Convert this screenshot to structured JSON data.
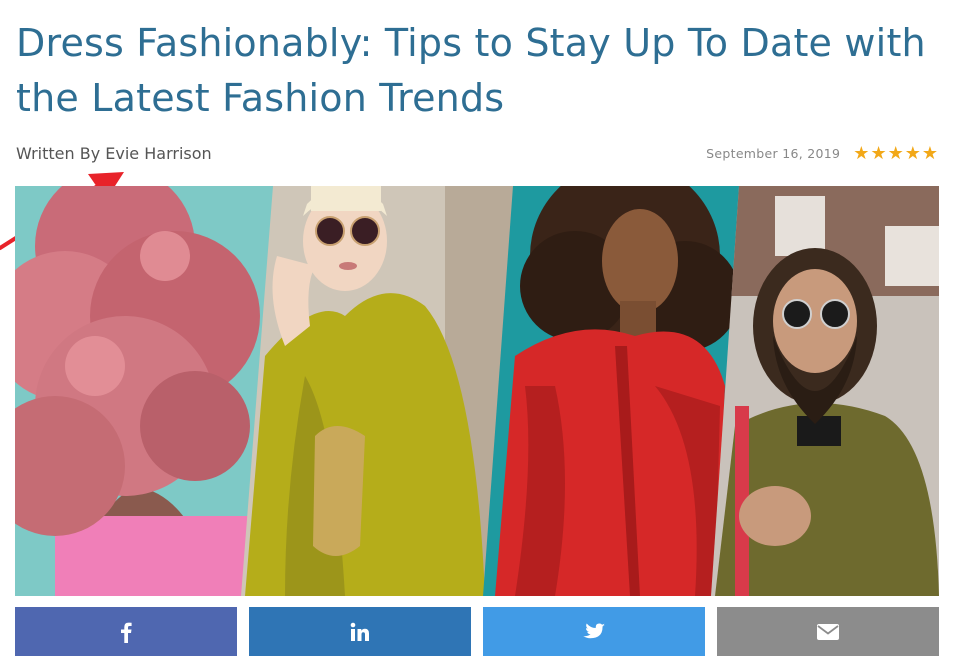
{
  "article": {
    "title": "Dress Fashionably: Tips to Stay Up To Date with the Latest Fashion Trends",
    "byline": "Written By Evie Harrison",
    "date": "September 16, 2019",
    "rating": 5
  },
  "hero": {
    "panels": [
      "pink-hair-model-icon",
      "sunglasses-velvet-model-icon",
      "red-jacket-model-icon",
      "bearded-man-icon"
    ]
  },
  "share": {
    "buttons": [
      {
        "network": "facebook",
        "icon": "facebook-icon",
        "color": "#4f67b0"
      },
      {
        "network": "linkedin",
        "icon": "linkedin-icon",
        "color": "#2f75b5"
      },
      {
        "network": "twitter",
        "icon": "twitter-icon",
        "color": "#419be6"
      },
      {
        "network": "email",
        "icon": "envelope-icon",
        "color": "#8c8c8c"
      }
    ]
  },
  "colors": {
    "title": "#2e6e93",
    "star": "#f2a818",
    "annotation_arrow": "#e8232a"
  }
}
